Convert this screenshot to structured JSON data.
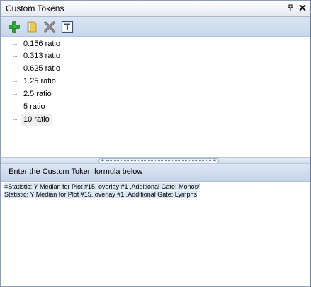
{
  "panel": {
    "title": "Custom Tokens",
    "pin_icon": "pin-icon",
    "close_icon": "close-icon"
  },
  "toolbar": {
    "items": [
      {
        "name": "add-token-button",
        "icon": "plus-icon",
        "color": "#2ca02c"
      },
      {
        "name": "bookmark-token-button",
        "icon": "bookmark-icon",
        "color": "#e0b030"
      },
      {
        "name": "delete-token-button",
        "icon": "x-icon",
        "color": "#7a7a7a"
      },
      {
        "name": "text-token-button",
        "icon": "text-T-icon",
        "color": "#3b4f6e"
      }
    ]
  },
  "tokens": [
    {
      "label": "0.156 ratio"
    },
    {
      "label": "0.313 ratio"
    },
    {
      "label": "0.625 ratio"
    },
    {
      "label": "1.25 ratio"
    },
    {
      "label": "2.5 ratio"
    },
    {
      "label": "5 ratio"
    },
    {
      "label": "10 ratio",
      "selected": true
    }
  ],
  "formula": {
    "header": "Enter the Custom Token formula below",
    "line1": "=Statistic: Y Median for Plot #15, overlay #1 ,Additional Gate: Monos/",
    "line2": "Statistic: Y Median for Plot #15, overlay #1 ,Additional Gate: Lymphs"
  }
}
